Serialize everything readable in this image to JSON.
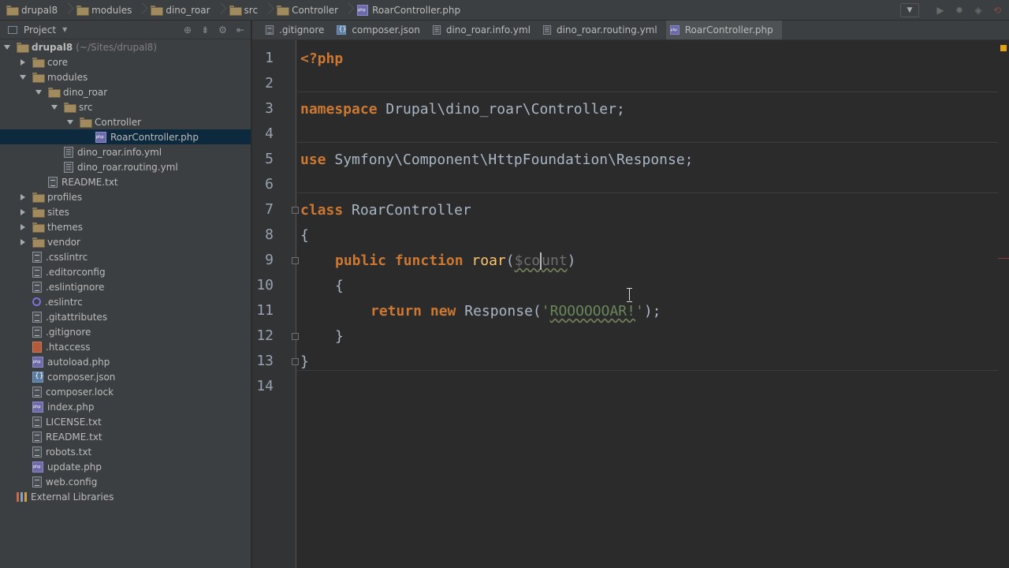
{
  "breadcrumb": [
    "drupal8",
    "modules",
    "dino_roar",
    "src",
    "Controller",
    "RoarController.php"
  ],
  "project_panel": {
    "title": "Project",
    "tree": [
      {
        "depth": 0,
        "arrow": "down",
        "icon": "folder-icon",
        "label": "drupal8",
        "hint": "(~/Sites/drupal8)"
      },
      {
        "depth": 1,
        "arrow": "right",
        "icon": "folder-icon",
        "label": "core"
      },
      {
        "depth": 1,
        "arrow": "down",
        "icon": "folder-icon",
        "label": "modules"
      },
      {
        "depth": 2,
        "arrow": "down",
        "icon": "folder-icon",
        "label": "dino_roar"
      },
      {
        "depth": 3,
        "arrow": "down",
        "icon": "folder-icon",
        "label": "src"
      },
      {
        "depth": 4,
        "arrow": "down",
        "icon": "folder-icon",
        "label": "Controller"
      },
      {
        "depth": 5,
        "arrow": "none",
        "icon": "php-file-icon",
        "label": "RoarController.php",
        "selected": true
      },
      {
        "depth": 3,
        "arrow": "none",
        "icon": "yml-file-icon",
        "label": "dino_roar.info.yml"
      },
      {
        "depth": 3,
        "arrow": "none",
        "icon": "yml-file-icon",
        "label": "dino_roar.routing.yml"
      },
      {
        "depth": 2,
        "arrow": "none",
        "icon": "text-file-icon",
        "label": "README.txt"
      },
      {
        "depth": 1,
        "arrow": "right",
        "icon": "folder-icon",
        "label": "profiles"
      },
      {
        "depth": 1,
        "arrow": "right",
        "icon": "folder-icon",
        "label": "sites"
      },
      {
        "depth": 1,
        "arrow": "right",
        "icon": "folder-icon",
        "label": "themes"
      },
      {
        "depth": 1,
        "arrow": "right",
        "icon": "folder-icon",
        "label": "vendor"
      },
      {
        "depth": 1,
        "arrow": "none",
        "icon": "text-file-icon",
        "label": ".csslintrc"
      },
      {
        "depth": 1,
        "arrow": "none",
        "icon": "text-file-icon",
        "label": ".editorconfig"
      },
      {
        "depth": 1,
        "arrow": "none",
        "icon": "text-file-icon",
        "label": ".eslintignore"
      },
      {
        "depth": 1,
        "arrow": "none",
        "icon": "eslint-icon",
        "label": ".eslintrc"
      },
      {
        "depth": 1,
        "arrow": "none",
        "icon": "text-file-icon",
        "label": ".gitattributes"
      },
      {
        "depth": 1,
        "arrow": "none",
        "icon": "text-file-icon",
        "label": ".gitignore"
      },
      {
        "depth": 1,
        "arrow": "none",
        "icon": "htaccess-icon",
        "label": ".htaccess"
      },
      {
        "depth": 1,
        "arrow": "none",
        "icon": "php-file-icon",
        "label": "autoload.php"
      },
      {
        "depth": 1,
        "arrow": "none",
        "icon": "json-file-icon",
        "label": "composer.json"
      },
      {
        "depth": 1,
        "arrow": "none",
        "icon": "text-file-icon",
        "label": "composer.lock"
      },
      {
        "depth": 1,
        "arrow": "none",
        "icon": "php-file-icon",
        "label": "index.php"
      },
      {
        "depth": 1,
        "arrow": "none",
        "icon": "text-file-icon",
        "label": "LICENSE.txt"
      },
      {
        "depth": 1,
        "arrow": "none",
        "icon": "text-file-icon",
        "label": "README.txt"
      },
      {
        "depth": 1,
        "arrow": "none",
        "icon": "text-file-icon",
        "label": "robots.txt"
      },
      {
        "depth": 1,
        "arrow": "none",
        "icon": "php-file-icon",
        "label": "update.php"
      },
      {
        "depth": 1,
        "arrow": "none",
        "icon": "text-file-icon",
        "label": "web.config"
      },
      {
        "depth": 0,
        "arrow": "none",
        "icon": "libraries-icon",
        "label": "External Libraries"
      }
    ]
  },
  "tabs": [
    {
      "label": ".gitignore",
      "icon": "text-file-icon"
    },
    {
      "label": "composer.json",
      "icon": "json-file-icon"
    },
    {
      "label": "dino_roar.info.yml",
      "icon": "yml-file-icon"
    },
    {
      "label": "dino_roar.routing.yml",
      "icon": "yml-file-icon"
    },
    {
      "label": "RoarController.php",
      "icon": "php-file-icon",
      "active": true
    }
  ],
  "editor": {
    "line_numbers": [
      "1",
      "2",
      "3",
      "4",
      "5",
      "6",
      "7",
      "8",
      "9",
      "10",
      "11",
      "12",
      "13",
      "14"
    ],
    "lines": {
      "l1": {
        "open_tag": "<?php"
      },
      "l3": {
        "kw": "namespace",
        "rest": " Drupal\\dino_roar\\Controller;"
      },
      "l5": {
        "kw": "use",
        "rest": " Symfony\\Component\\HttpFoundation\\Response;"
      },
      "l7": {
        "kw": "class",
        "rest": " RoarController"
      },
      "l8": {
        "text": "{"
      },
      "l9": {
        "kw1": "public",
        "kw2": "function",
        "fn": "roar",
        "open": "(",
        "var_a": "$co",
        "var_b": "unt",
        "close": ")"
      },
      "l10": {
        "text": "{"
      },
      "l11": {
        "kw1": "return",
        "kw2": "new",
        "cls": " Response(",
        "str_q1": "'",
        "str": "ROOOOOOAR!",
        "str_q2": "'",
        "end": ");"
      },
      "l12": {
        "text": "}"
      },
      "l13": {
        "text": "}"
      }
    }
  },
  "colors": {
    "keyword": "#cc7832",
    "string": "#6a8759",
    "function": "#ffc66d",
    "unused_var": "#6e6e6e",
    "text": "#a9b7c6",
    "selection": "#0d293e"
  }
}
